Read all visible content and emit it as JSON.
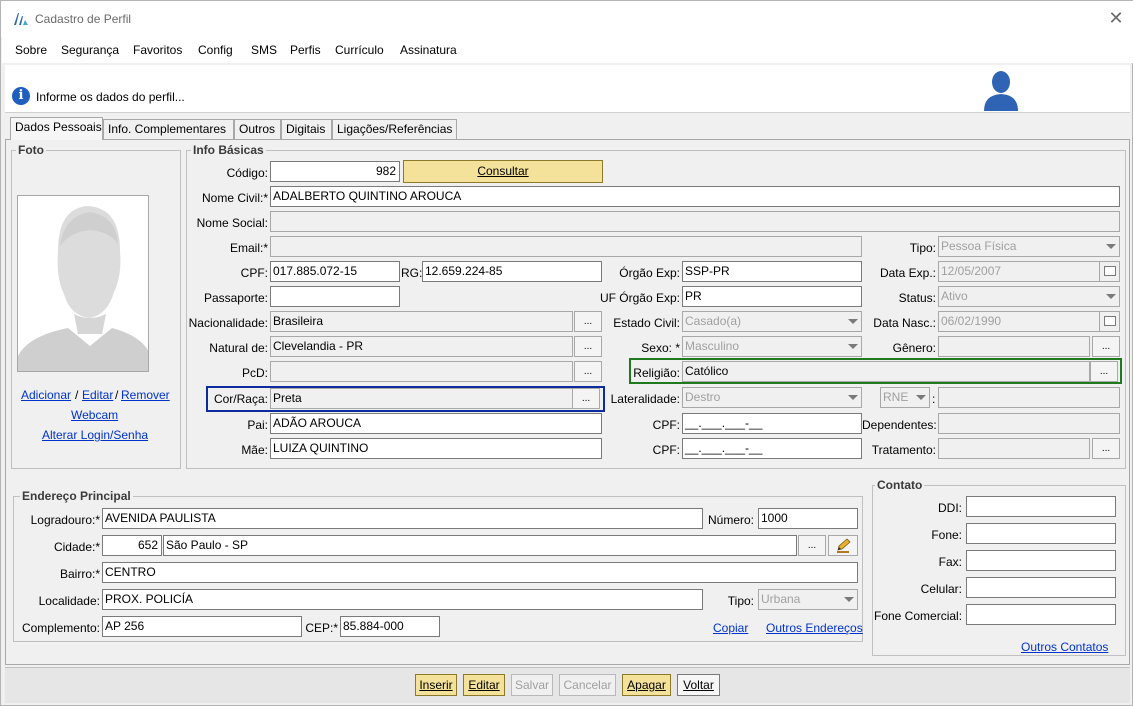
{
  "window": {
    "title": "Cadastro de Perfil",
    "close_glyph": "✕"
  },
  "menu": [
    "Sobre",
    "Segurança",
    "Favoritos",
    "Config",
    "SMS",
    "Perfis",
    "Currículo",
    "Assinatura"
  ],
  "banner": {
    "info_glyph": "i",
    "text": "Informe os dados do perfil..."
  },
  "tabs": [
    "Dados Pessoais",
    "Info. Complementares",
    "Outros",
    "Digitais",
    "Ligações/Referências"
  ],
  "foto": {
    "title": "Foto",
    "adicionar": "Adicionar",
    "sep": "/",
    "editar": "Editar",
    "remover": "Remover",
    "webcam": "Webcam",
    "alterar_login": "Alterar Login/Senha"
  },
  "info_basicas": {
    "title": "Info Básicas",
    "codigo_label": "Código:",
    "codigo": "982",
    "consultar": "Consultar",
    "nome_civil_label": "Nome Civil:*",
    "nome_civil": "ADALBERTO QUINTINO AROUCA",
    "nome_social_label": "Nome Social:",
    "nome_social": "",
    "email_label": "Email:*",
    "email": "",
    "tipo_label": "Tipo:",
    "tipo": "Pessoa Física",
    "cpf_label": "CPF:",
    "cpf": "017.885.072-15",
    "rg_label": "RG:",
    "rg": "12.659.224-85",
    "orgao_exp_label": "Órgão Exp:",
    "orgao_exp": "SSP-PR",
    "data_exp_label": "Data Exp.:",
    "data_exp": "12/05/2007",
    "passaporte_label": "Passaporte:",
    "passaporte": "",
    "uf_orgao_label": "UF Órgão Exp:",
    "uf_orgao": "PR",
    "status_label": "Status:",
    "status": "Ativo",
    "nacionalidade_label": "Nacionalidade:",
    "nacionalidade": "Brasileira",
    "estado_civil_label": "Estado Civil:",
    "estado_civil": "Casado(a)",
    "data_nasc_label": "Data Nasc.:",
    "data_nasc": "06/02/1990",
    "natural_label": "Natural de:",
    "natural": "Clevelandia - PR",
    "sexo_label": "Sexo: *",
    "sexo": "Masculino",
    "genero_label": "Gênero:",
    "genero": "",
    "pcd_label": "PcD:",
    "pcd": "",
    "religiao_label": "Religião:",
    "religiao": "Católico",
    "cor_label": "Cor/Raça:",
    "cor": "Preta",
    "lateralidade_label": "Lateralidade:",
    "lateralidade": "Destro",
    "rne": "RNE",
    "rne_colon": ":",
    "rne_value": "",
    "pai_label": "Pai:",
    "pai": "ADÃO AROUCA",
    "pai_cpf_label": "CPF:",
    "pai_cpf": "__.___.___-__",
    "dependentes_label": "Dependentes:",
    "dependentes": "",
    "mae_label": "Mãe:",
    "mae": "LUIZA QUINTINO",
    "mae_cpf_label": "CPF:",
    "mae_cpf": "__.___.___-__",
    "tratamento_label": "Tratamento:",
    "tratamento": "",
    "dots": "..."
  },
  "endereco": {
    "title": "Endereço Principal",
    "logradouro_label": "Logradouro:*",
    "logradouro": "AVENIDA PAULISTA",
    "numero_label": "Número:",
    "numero": "1000",
    "cidade_label": "Cidade:*",
    "cidade_codigo": "652",
    "cidade": "São Paulo - SP",
    "bairro_label": "Bairro:*",
    "bairro": "CENTRO",
    "localidade_label": "Localidade:",
    "localidade": "PROX. POLICÍA",
    "tipo_label": "Tipo:",
    "tipo": "Urbana",
    "complemento_label": "Complemento:",
    "complemento": "AP 256",
    "cep_label": "CEP:*",
    "cep": "85.884-000",
    "copiar": "Copiar",
    "outros_enderecos": "Outros Endereços"
  },
  "contato": {
    "title": "Contato",
    "ddi_label": "DDI:",
    "fone_label": "Fone:",
    "fax_label": "Fax:",
    "celular_label": "Celular:",
    "fone_comercial_label": "Fone Comercial:",
    "outros_contatos": "Outros Contatos"
  },
  "actions": {
    "inserir": "Inserir",
    "editar": "Editar",
    "salvar": "Salvar",
    "cancelar": "Cancelar",
    "apagar": "Apagar",
    "voltar": "Voltar"
  },
  "colors": {
    "highlight_blue": "#0b2c9c",
    "highlight_green": "#1f7a1f",
    "button_yellow": "#f4e29a",
    "link_blue": "#0033cc",
    "user_icon_blue": "#2f64b4"
  }
}
